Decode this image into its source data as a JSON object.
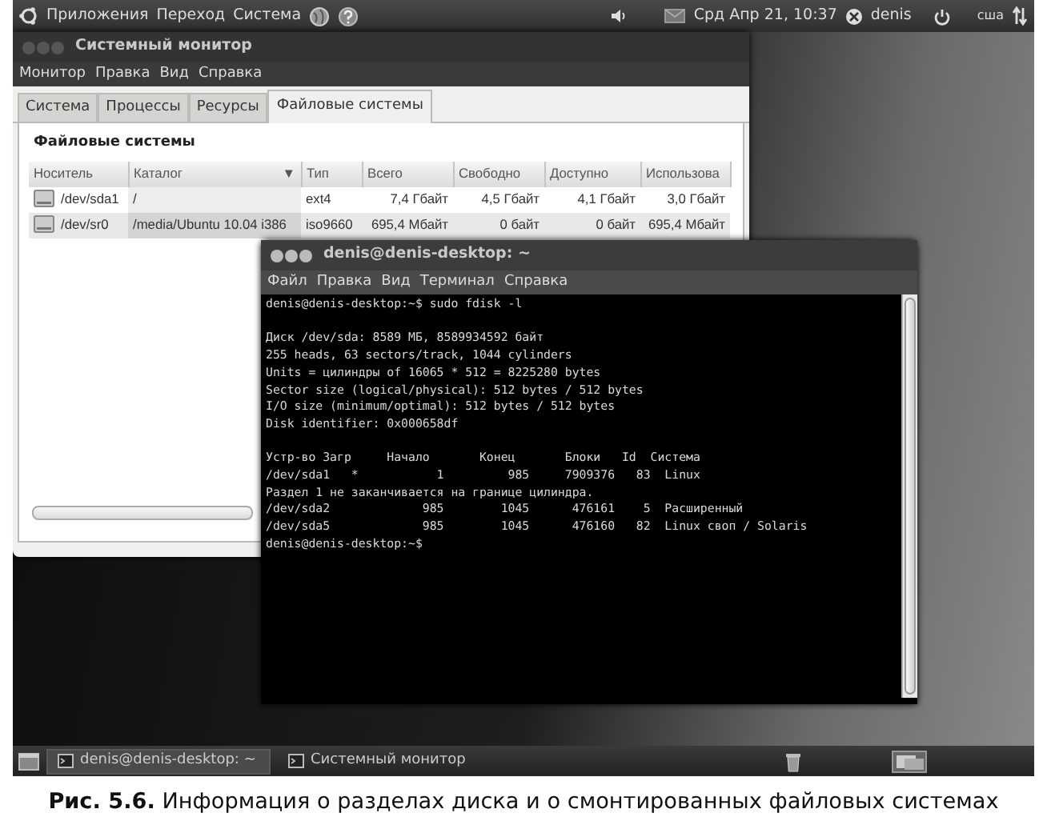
{
  "top_panel": {
    "menus": [
      "Приложения",
      "Переход",
      "Система"
    ],
    "clock": "Срд Апр 21, 10:37",
    "user": "denis",
    "keyboard_layout": "сша"
  },
  "system_monitor": {
    "title": "Системный монитор",
    "menus": [
      "Монитор",
      "Правка",
      "Вид",
      "Справка"
    ],
    "tabs": [
      {
        "label": "Система",
        "selected": false
      },
      {
        "label": "Процессы",
        "selected": false
      },
      {
        "label": "Ресурсы",
        "selected": false
      },
      {
        "label": "Файловые системы",
        "selected": true
      }
    ],
    "section_title": "Файловые системы",
    "table": {
      "columns": [
        {
          "label": "Носитель"
        },
        {
          "label": "Каталог",
          "sort_indicator": "▼"
        },
        {
          "label": "Тип"
        },
        {
          "label": "Всего"
        },
        {
          "label": "Свободно"
        },
        {
          "label": "Доступно"
        },
        {
          "label": "Использова"
        }
      ],
      "rows": [
        [
          "/dev/sda1",
          "/",
          "ext4",
          "7,4 Гбайт",
          "4,5 Гбайт",
          "4,1 Гбайт",
          "3,0 Гбайт"
        ],
        [
          "/dev/sr0",
          "/media/Ubuntu 10.04 i386",
          "iso9660",
          "695,4 Мбайт",
          "0 байт",
          "0 байт",
          "695,4 Мбайт"
        ]
      ]
    }
  },
  "terminal": {
    "title": "denis@denis-desktop: ~",
    "menus": [
      "Файл",
      "Правка",
      "Вид",
      "Терминал",
      "Справка"
    ],
    "blocks": [
      [
        "denis@denis-desktop:~$ sudo fdisk -l"
      ],
      [
        "Диск /dev/sda: 8589 МБ, 8589934592 байт",
        "255 heads, 63 sectors/track, 1044 cylinders",
        "Units = цилиндры of 16065 * 512 = 8225280 bytes",
        "Sector size (logical/physical): 512 bytes / 512 bytes",
        "I/O size (minimum/optimal): 512 bytes / 512 bytes",
        "Disk identifier: 0x000658df"
      ],
      [
        "Устр-во Загр     Начало       Конец       Блоки   Id  Система",
        "/dev/sda1   *           1         985     7909376   83  Linux",
        "Раздел 1 не заканчивается на границе цилиндра.",
        "/dev/sda2             985        1045      476161    5  Расширенный",
        "/dev/sda5             985        1045      476160   82  Linux своп / Solaris",
        "denis@denis-desktop:~$"
      ]
    ]
  },
  "taskbar": {
    "items": [
      {
        "label": "denis@denis-desktop: ~",
        "selected": true
      },
      {
        "label": "Системный монитор",
        "selected": false
      }
    ]
  },
  "caption": "**Рис. 5.6.** Информация о разделах диска и о смонтированных файловых системах"
}
